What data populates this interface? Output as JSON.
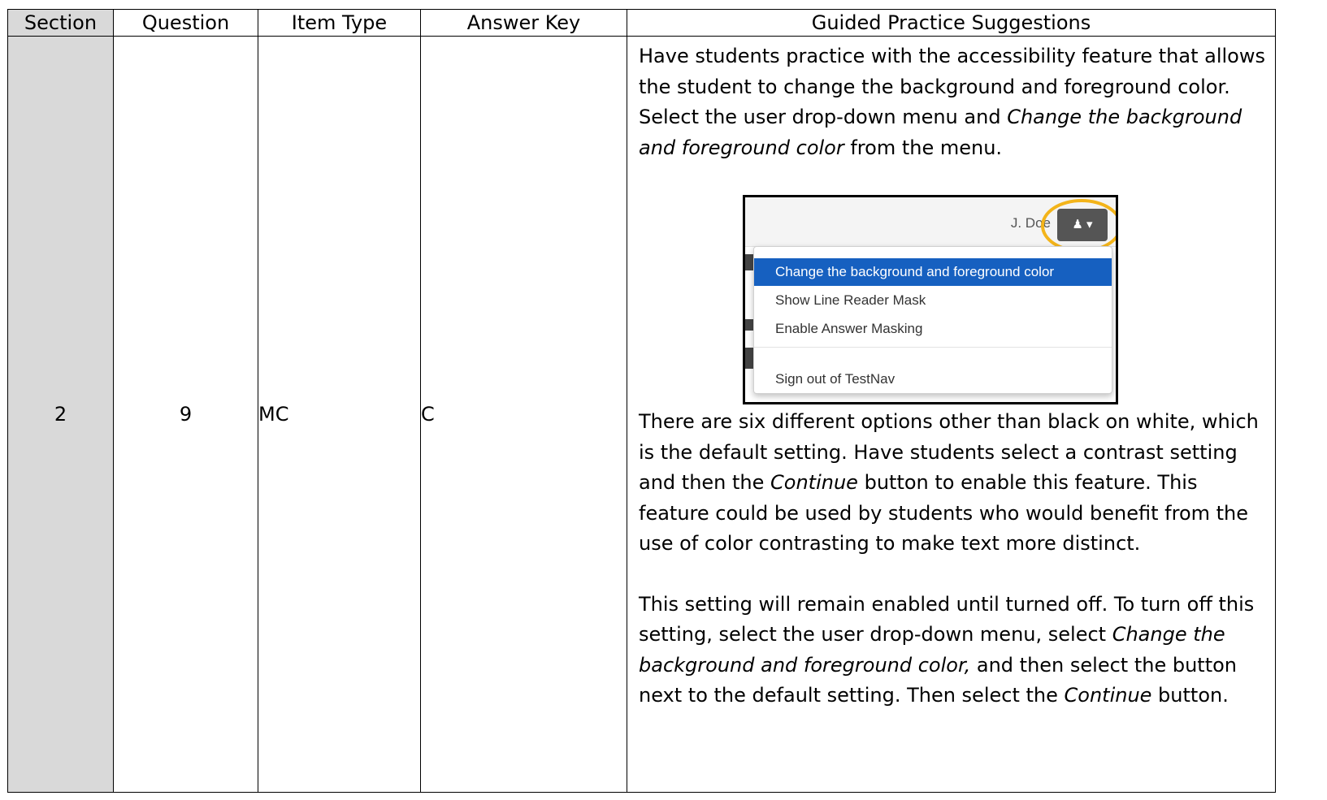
{
  "table": {
    "headers": {
      "section": "Section",
      "question": "Question",
      "item_type": "Item Type",
      "answer_key": "Answer Key",
      "guided": "Guided Practice Suggestions"
    },
    "row": {
      "section": "2",
      "question": "9",
      "item_type": "MC",
      "answer_key": "C"
    }
  },
  "guide": {
    "p1_a": "Have students practice with the accessibility feature that allows the student to change the background and foreground color.  Select the user drop-down menu and ",
    "p1_em": "Change the background and foreground color",
    "p1_b": " from the menu.",
    "p2_a": "There are six different options other than black on white, which is the default setting.  Have students select a contrast setting and then the ",
    "p2_em": "Continue",
    "p2_b": " button to enable this feature.  This feature could be used by students who would benefit from the use of color contrasting to make text more distinct.",
    "p3_a": "This setting will remain enabled until turned off.  To turn off this setting, select the user drop-down menu, select ",
    "p3_em1": "Change the background and foreground color,",
    "p3_b": " and then select the button next to the default setting.  Then select the ",
    "p3_em2": "Continue",
    "p3_c": " button."
  },
  "screenshot": {
    "user_name": "J. Doe",
    "user_icon": "user-icon",
    "caret_icon": "caret-down-icon",
    "menu_items": [
      "Change the background and foreground color",
      "Show Line Reader Mask",
      "Enable Answer Masking",
      "Sign out of TestNav"
    ],
    "active_item": 0,
    "highlight_color": "#1660c0",
    "ring_color": "#f3b41a"
  }
}
